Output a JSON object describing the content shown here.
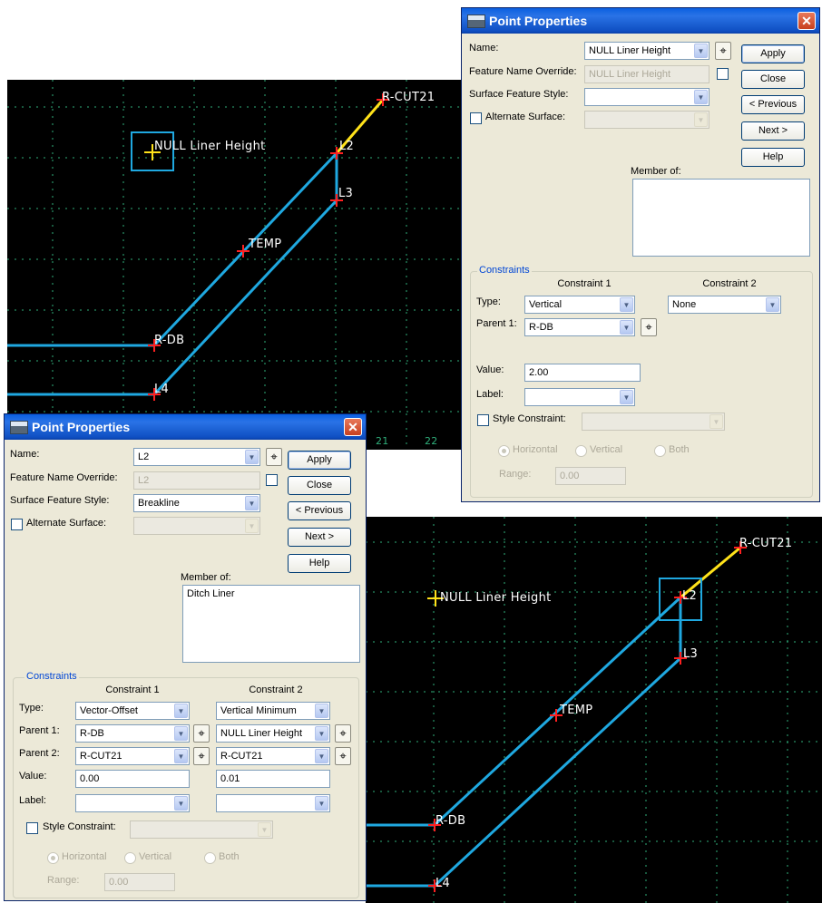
{
  "dialog_top": {
    "title": "Point Properties",
    "name_label": "Name:",
    "name_value": "NULL Liner Height",
    "fno_label": "Feature Name Override:",
    "fno_value": "NULL Liner Height",
    "sfs_label": "Surface Feature Style:",
    "sfs_value": "",
    "alt_label": "Alternate Surface:",
    "alt_value": "",
    "member_label": "Member of:",
    "members": [],
    "buttons": {
      "apply": "Apply",
      "close": "Close",
      "previous": "< Previous",
      "next": "Next >",
      "help": "Help"
    },
    "constraints_label": "Constraints",
    "c1_header": "Constraint 1",
    "c2_header": "Constraint 2",
    "type_label": "Type:",
    "type1": "Vertical",
    "type2": "None",
    "parent1_label": "Parent 1:",
    "parent1_c1": "R-DB",
    "value_label": "Value:",
    "value1": "2.00",
    "label_label": "Label:",
    "label1": "",
    "style_label": "Style Constraint:",
    "style_value": "",
    "radio_horizontal": "Horizontal",
    "radio_vertical": "Vertical",
    "radio_both": "Both",
    "range_label": "Range:",
    "range_value": "0.00"
  },
  "dialog_bottom": {
    "title": "Point Properties",
    "name_label": "Name:",
    "name_value": "L2",
    "fno_label": "Feature Name Override:",
    "fno_value": "L2",
    "sfs_label": "Surface Feature Style:",
    "sfs_value": "Breakline",
    "alt_label": "Alternate Surface:",
    "alt_value": "",
    "member_label": "Member of:",
    "members": [
      "Ditch Liner"
    ],
    "buttons": {
      "apply": "Apply",
      "close": "Close",
      "previous": "< Previous",
      "next": "Next >",
      "help": "Help"
    },
    "constraints_label": "Constraints",
    "c1_header": "Constraint 1",
    "c2_header": "Constraint 2",
    "type_label": "Type:",
    "type1": "Vector-Offset",
    "type2": "Vertical Minimum",
    "parent1_label": "Parent 1:",
    "parent1_c1": "R-DB",
    "parent1_c2": "NULL Liner Height",
    "parent2_label": "Parent 2:",
    "parent2_c1": "R-CUT21",
    "parent2_c2": "R-CUT21",
    "value_label": "Value:",
    "value1": "0.00",
    "value2": "0.01",
    "label_label": "Label:",
    "label1": "",
    "label2": "",
    "style_label": "Style Constraint:",
    "style_value": "",
    "radio_horizontal": "Horizontal",
    "radio_vertical": "Vertical",
    "radio_both": "Both",
    "range_label": "Range:",
    "range_value": "0.00"
  },
  "cad_top": {
    "labels": {
      "rcut": "R-CUT21",
      "null": "NULL Liner Height",
      "l2": "L2",
      "l3": "L3",
      "temp": "TEMP",
      "rdb": "R-DB",
      "l4": "L4"
    },
    "ticks": [
      "21",
      "22"
    ]
  },
  "cad_bottom": {
    "labels": {
      "rcut": "R-CUT21",
      "null": "NULL Liner Height",
      "l2": "L2",
      "l3": "L3",
      "temp": "TEMP",
      "rdb": "R-DB",
      "l4": "L4"
    }
  },
  "colors": {
    "line": "#1fa8e0",
    "highlight": "#ffe21a",
    "marker": "#ff2020",
    "grid": "#2fae7a",
    "select": "#1fa8e0"
  },
  "icons": [
    "window-icon",
    "close-icon",
    "dropdown-arrow-icon",
    "pick-point-icon",
    "crosshair-icon"
  ]
}
